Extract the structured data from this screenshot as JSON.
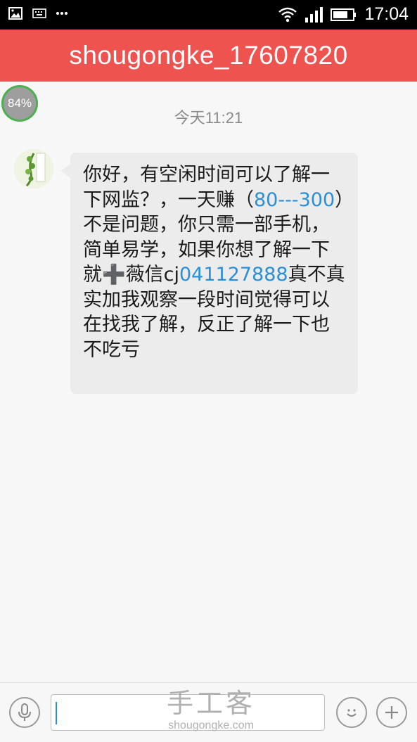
{
  "status_bar": {
    "time": "17:04",
    "left_icons": [
      "image-icon",
      "keyboard-icon",
      "more-icon"
    ],
    "right_icons": [
      "wifi-icon",
      "signal-icon",
      "battery-icon"
    ]
  },
  "header": {
    "title": "shougongke_17607820"
  },
  "overlay": {
    "battery_percent": "84%"
  },
  "chat": {
    "timestamp": "今天11:21",
    "message": {
      "parts": [
        {
          "text": "你好，有空闲时间可以了解一下网监？，一天赚（",
          "type": "text"
        },
        {
          "text": "80---300",
          "type": "link"
        },
        {
          "text": "）不是问题，你只需一部手机，简单易学，如果你想了解一下就",
          "type": "text"
        },
        {
          "text": "➕",
          "type": "emoji"
        },
        {
          "text": "薇信cj",
          "type": "text"
        },
        {
          "text": "041127888",
          "type": "link"
        },
        {
          "text": "真不真实加我观察一段时间觉得可以在找我了解，反正了解一下也 不吃亏",
          "type": "text"
        }
      ]
    }
  },
  "input_bar": {
    "left_icon": "microphone-icon",
    "right_icons": [
      "emoji-icon",
      "add-icon"
    ],
    "input_value": ""
  },
  "watermark": {
    "title": "手工客",
    "url": "shougongke.com"
  },
  "colors": {
    "header_bg": "#ef5350",
    "link": "#2b8fd6",
    "bubble_bg": "#ececec"
  }
}
